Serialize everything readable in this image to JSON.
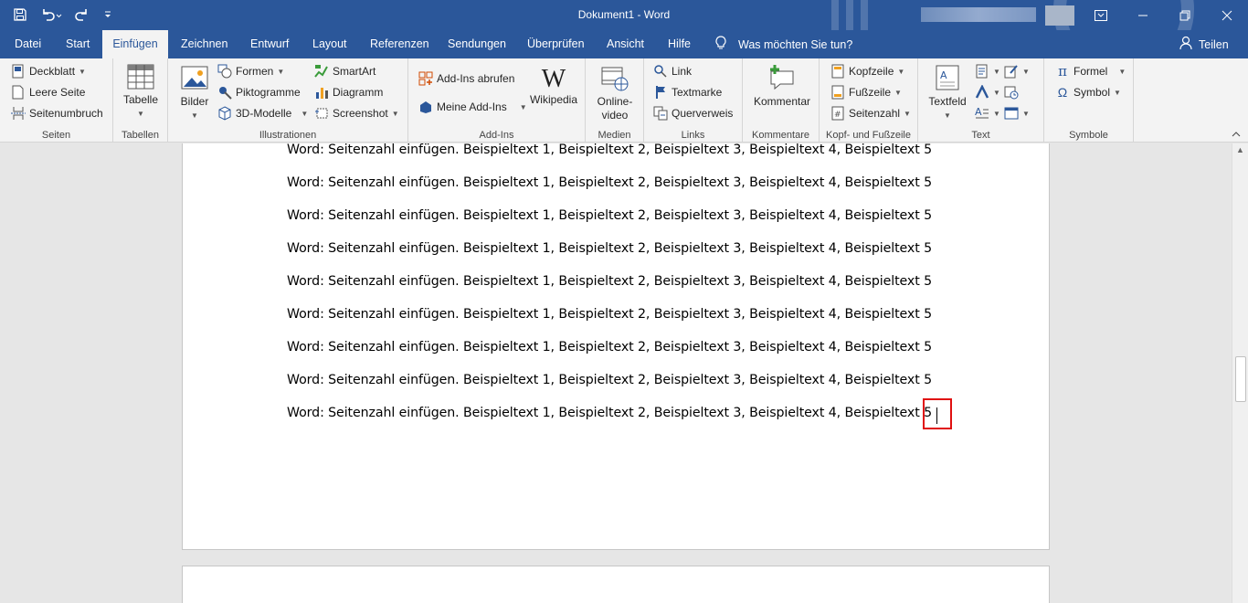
{
  "titlebar": {
    "title": "Dokument1 - Word"
  },
  "tabs": [
    {
      "label": "Datei"
    },
    {
      "label": "Start"
    },
    {
      "label": "Einfügen",
      "active": true
    },
    {
      "label": "Zeichnen"
    },
    {
      "label": "Entwurf"
    },
    {
      "label": "Layout"
    },
    {
      "label": "Referenzen"
    },
    {
      "label": "Sendungen"
    },
    {
      "label": "Überprüfen"
    },
    {
      "label": "Ansicht"
    },
    {
      "label": "Hilfe"
    }
  ],
  "tellme": {
    "label": "Was möchten Sie tun?"
  },
  "share": {
    "label": "Teilen"
  },
  "ribbon": {
    "seiten": {
      "label": "Seiten",
      "deckblatt": "Deckblatt",
      "leere_seite": "Leere Seite",
      "seitenumbruch": "Seitenumbruch"
    },
    "tabellen": {
      "label": "Tabellen",
      "tabelle": "Tabelle"
    },
    "illustrationen": {
      "label": "Illustrationen",
      "bilder": "Bilder",
      "formen": "Formen",
      "piktogramme": "Piktogramme",
      "modelle": "3D-Modelle",
      "smartart": "SmartArt",
      "diagramm": "Diagramm",
      "screenshot": "Screenshot"
    },
    "addins": {
      "label": "Add-Ins",
      "abrufen": "Add-Ins abrufen",
      "meine": "Meine Add-Ins",
      "wikipedia": "Wikipedia"
    },
    "medien": {
      "label": "Medien",
      "online1": "Online-",
      "online2": "video"
    },
    "links": {
      "label": "Links",
      "link": "Link",
      "textmarke": "Textmarke",
      "querverweis": "Querverweis"
    },
    "kommentare": {
      "label": "Kommentare",
      "kommentar": "Kommentar"
    },
    "kopf": {
      "label": "Kopf- und Fußzeile",
      "kopfzeile": "Kopfzeile",
      "fusszeile": "Fußzeile",
      "seitenzahl": "Seitenzahl"
    },
    "text": {
      "label": "Text",
      "textfeld": "Textfeld"
    },
    "symbole": {
      "label": "Symbole",
      "formel": "Formel",
      "symbol": "Symbol"
    }
  },
  "document": {
    "lines": [
      "Word: Seitenzahl einfügen. Beispieltext 1, Beispieltext 2, Beispieltext 3, Beispieltext 4, Beispieltext 5",
      "Word: Seitenzahl einfügen. Beispieltext 1, Beispieltext 2, Beispieltext 3, Beispieltext 4, Beispieltext 5",
      "Word: Seitenzahl einfügen. Beispieltext 1, Beispieltext 2, Beispieltext 3, Beispieltext 4, Beispieltext 5",
      "Word: Seitenzahl einfügen. Beispieltext 1, Beispieltext 2, Beispieltext 3, Beispieltext 4, Beispieltext 5",
      "Word: Seitenzahl einfügen. Beispieltext 1, Beispieltext 2, Beispieltext 3, Beispieltext 4, Beispieltext 5",
      "Word: Seitenzahl einfügen. Beispieltext 1, Beispieltext 2, Beispieltext 3, Beispieltext 4, Beispieltext 5",
      "Word: Seitenzahl einfügen. Beispieltext 1, Beispieltext 2, Beispieltext 3, Beispieltext 4, Beispieltext 5",
      "Word: Seitenzahl einfügen. Beispieltext 1, Beispieltext 2, Beispieltext 3, Beispieltext 4, Beispieltext 5",
      "Word: Seitenzahl einfügen. Beispieltext 1, Beispieltext 2, Beispieltext 3, Beispieltext 4, Beispieltext 5"
    ]
  },
  "colors": {
    "brand": "#2b579a",
    "highlight": "#e01010"
  }
}
